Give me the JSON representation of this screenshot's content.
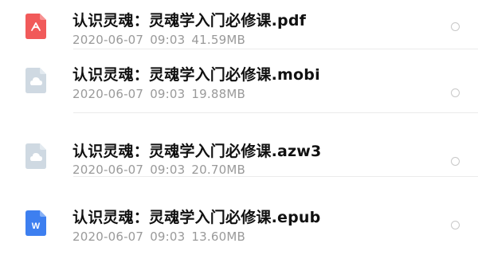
{
  "files": [
    {
      "name": "认识灵魂：灵魂学入门必修课.pdf",
      "date": "2020-06-07",
      "time": "09:03",
      "size": "41.59MB",
      "icon": "pdf-icon",
      "icon_color": "#f15a5a"
    },
    {
      "name": "认识灵魂：灵魂学入门必修课.mobi",
      "date": "2020-06-07",
      "time": "09:03",
      "size": "19.88MB",
      "icon": "cloud-file-icon",
      "icon_color": "#cfd9e2"
    },
    {
      "name": "认识灵魂：灵魂学入门必修课.azw3",
      "date": "2020-06-07",
      "time": "09:03",
      "size": "20.70MB",
      "icon": "cloud-file-icon",
      "icon_color": "#cfd9e2"
    },
    {
      "name": "认识灵魂：灵魂学入门必修课.epub",
      "date": "2020-06-07",
      "time": "09:03",
      "size": "13.60MB",
      "icon": "word-doc-icon",
      "icon_color": "#3d7ff0"
    }
  ],
  "icon_glyphs": {
    "word": "W"
  }
}
